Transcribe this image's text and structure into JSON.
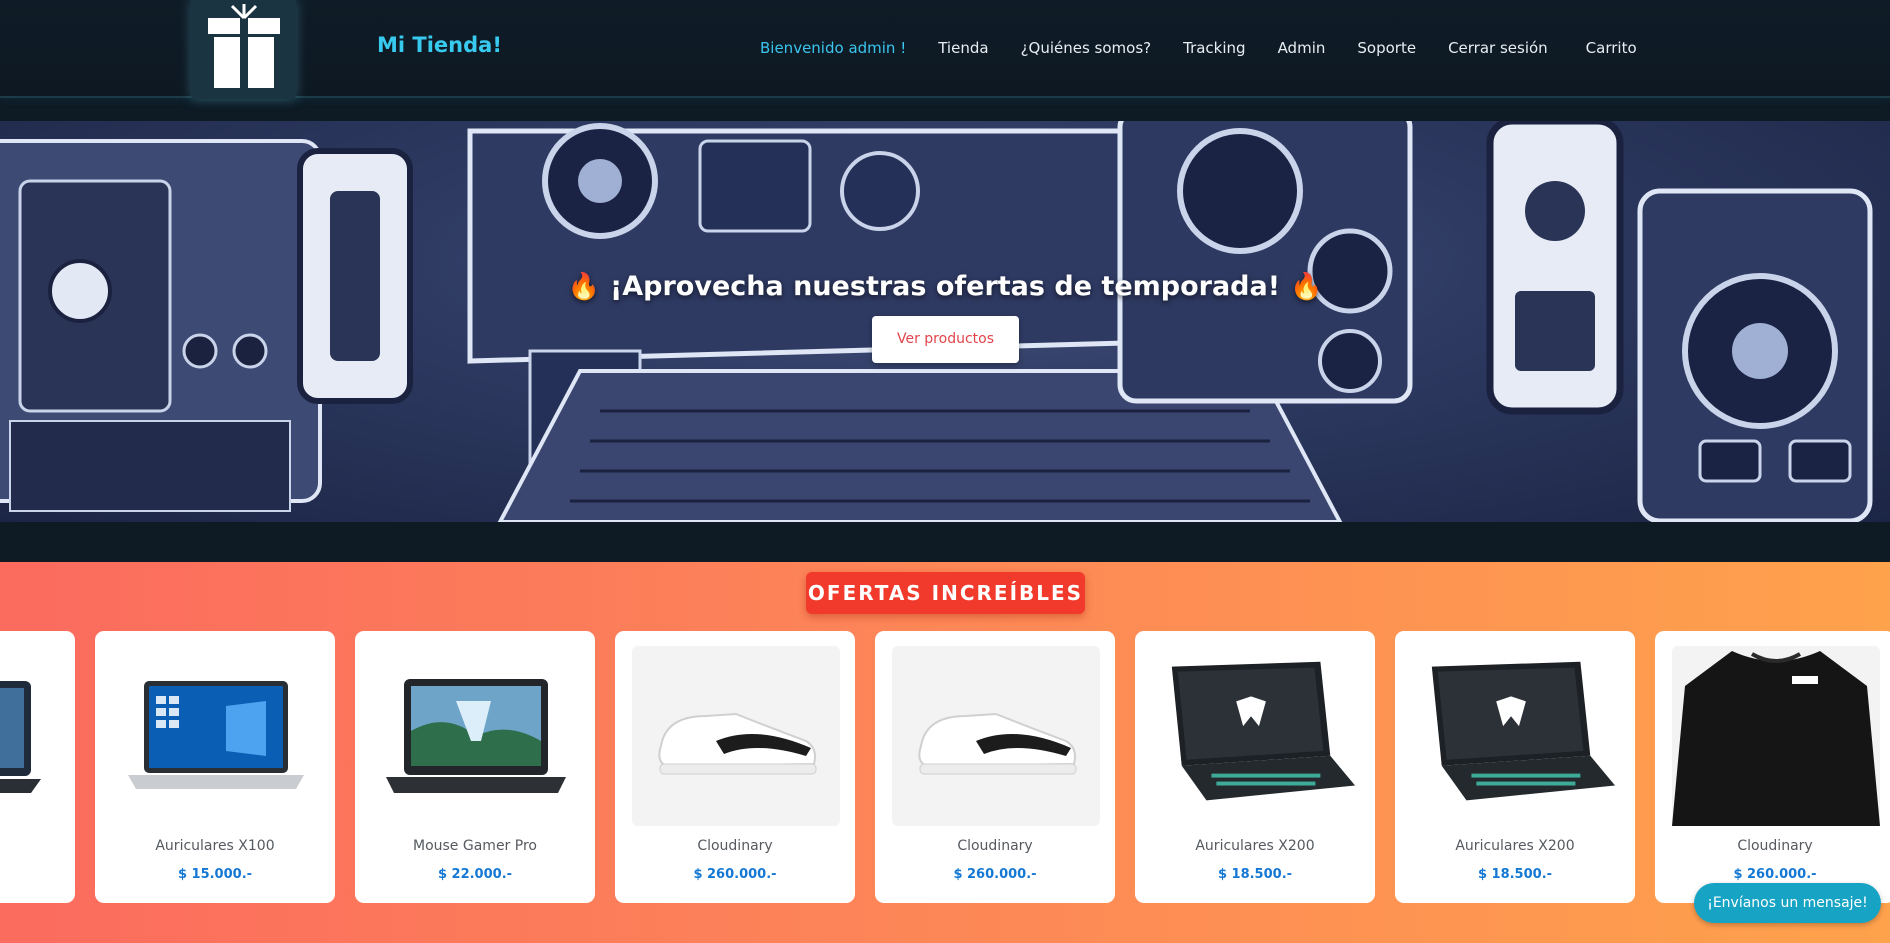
{
  "brand": "Mi Tienda!",
  "nav": {
    "welcome": "Bienvenido admin !",
    "items": [
      "Tienda",
      "¿Quiénes somos?",
      "Tracking",
      "Admin",
      "Soporte",
      "Cerrar sesión",
      "Carrito"
    ]
  },
  "hero": {
    "title": "¡Aprovecha nuestras ofertas de temporada!",
    "flame": "🔥",
    "button": "Ver productos"
  },
  "ofertas": {
    "badge": "OFERTAS INCREÍBLES",
    "products": [
      {
        "name": "ro",
        "price": ""
      },
      {
        "name": "Auriculares X100",
        "price": "$ 15.000.-"
      },
      {
        "name": "Mouse Gamer Pro",
        "price": "$ 22.000.-"
      },
      {
        "name": "Cloudinary",
        "price": "$ 260.000.-"
      },
      {
        "name": "Cloudinary",
        "price": "$ 260.000.-"
      },
      {
        "name": "Auriculares X200",
        "price": "$ 18.500.-"
      },
      {
        "name": "Auriculares X200",
        "price": "$ 18.500.-"
      },
      {
        "name": "Cloudinary",
        "price": "$ 260.000.-"
      }
    ]
  },
  "chat": "¡Envíanos un mensaje!",
  "colors": {
    "accent": "#38c9ef",
    "badge": "#f13a2c",
    "price": "#1478d4",
    "chat": "#17a3c4"
  }
}
